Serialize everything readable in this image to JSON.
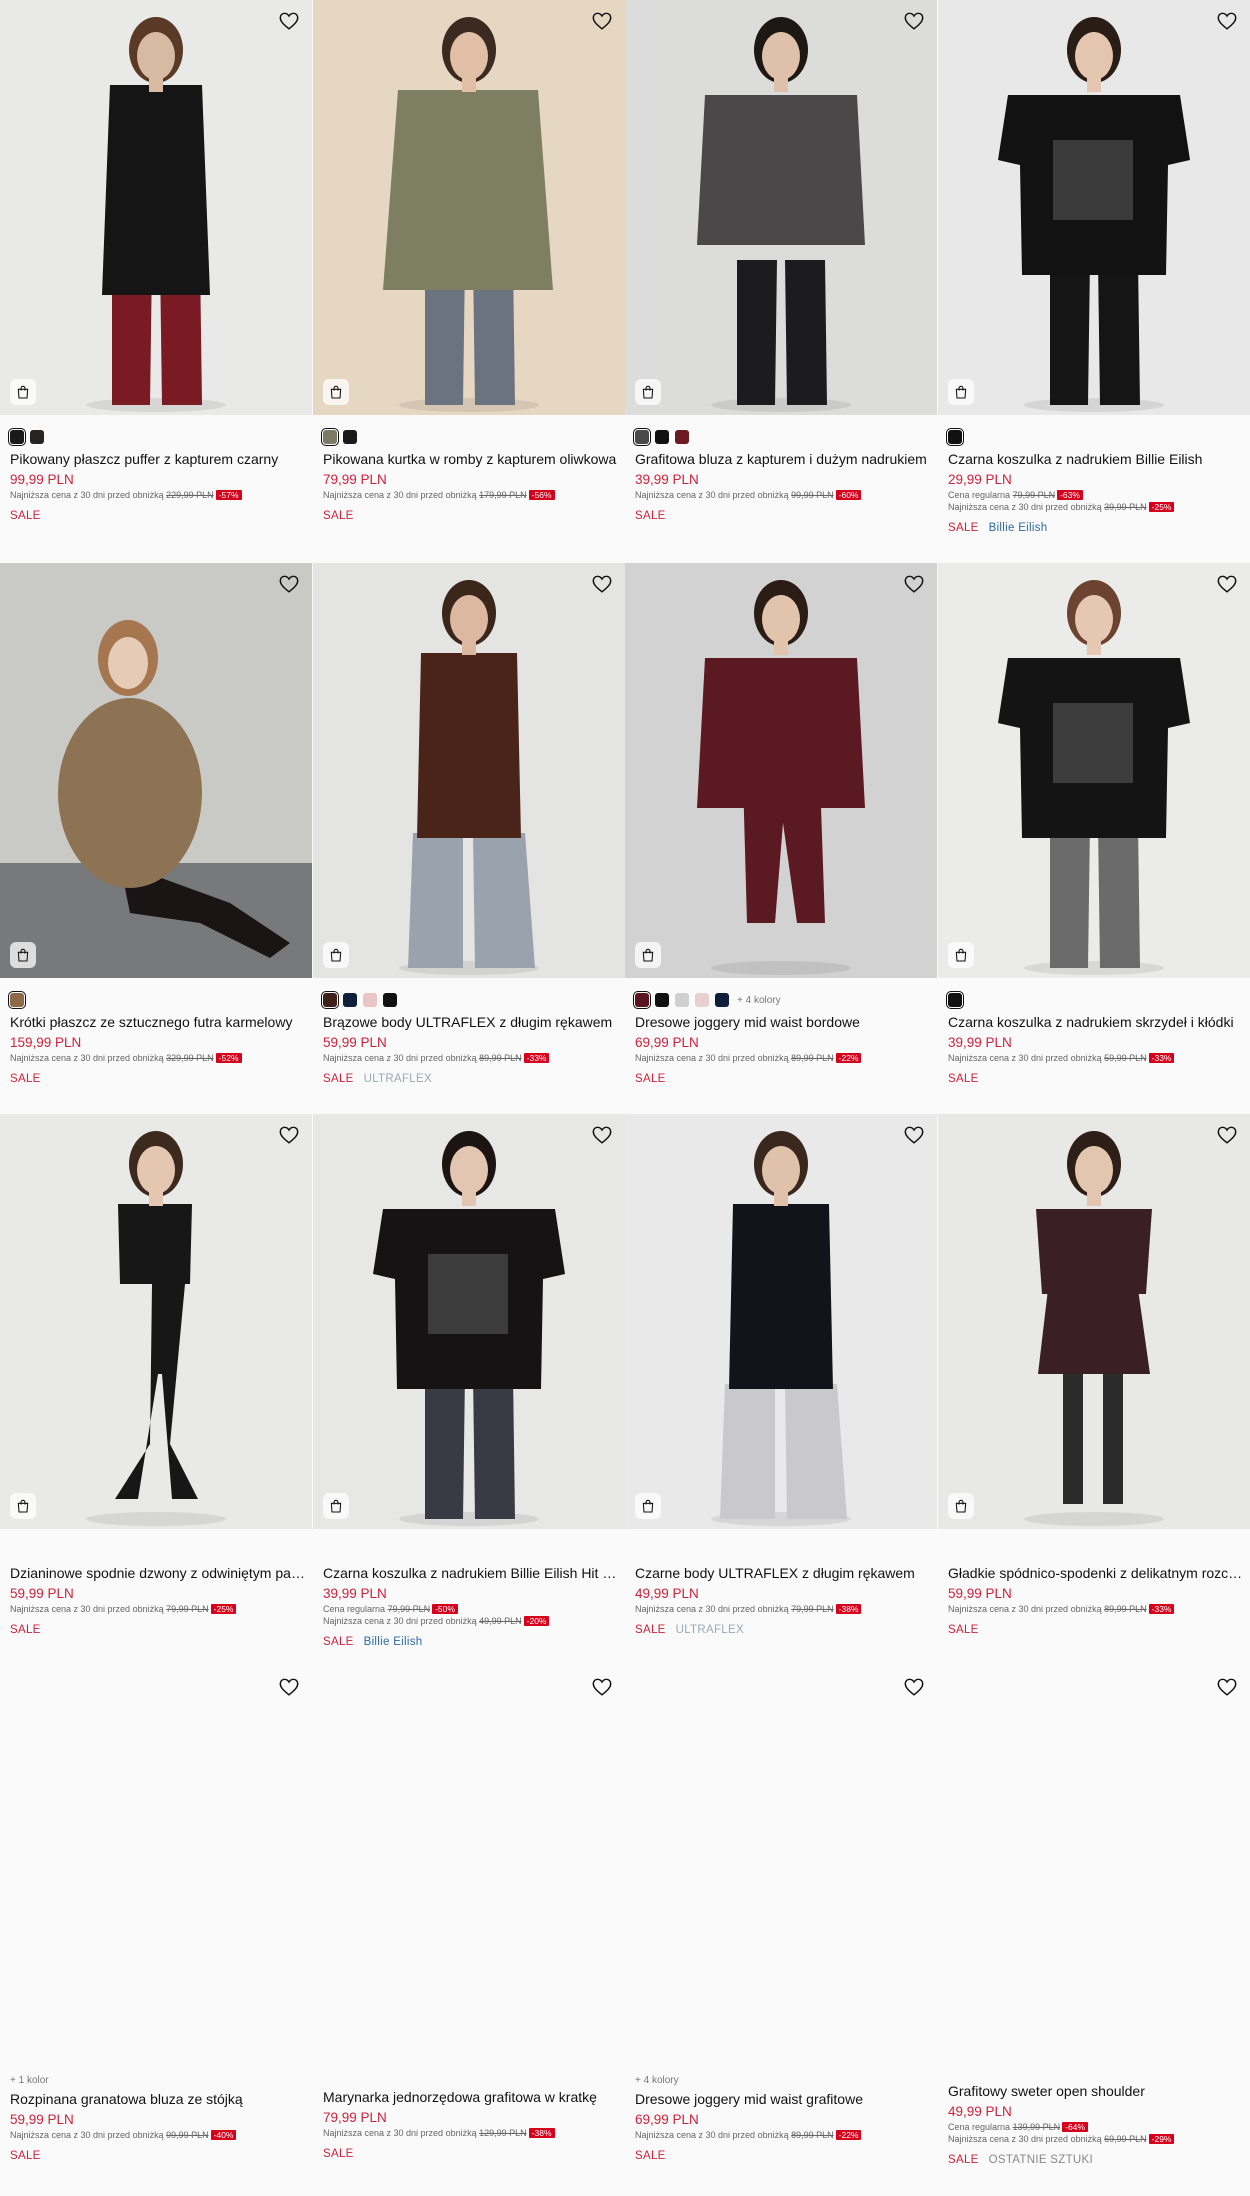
{
  "products": [
    {
      "name": "Pikowany płaszcz puffer z kapturem czarny",
      "price": "99,99 PLN",
      "lines": [
        {
          "label": "Najniższa cena z 30 dni przed obniżką",
          "old": "229,99 PLN",
          "discount": "-57%"
        }
      ],
      "tags": {
        "sale": "SALE"
      },
      "swatches": [
        "#1a1a1a",
        "#2a2420"
      ],
      "image": {
        "bg": "#e9e9e7",
        "garment": "#151515",
        "lower": "#7a1a22",
        "skin": "#d8b9a2",
        "hair": "#5a3a26",
        "style": "long"
      }
    },
    {
      "name": "Pikowana kurtka w romby z kapturem oliwkowa",
      "price": "79,99 PLN",
      "lines": [
        {
          "label": "Najniższa cena z 30 dni przed obniżką",
          "old": "179,99 PLN",
          "discount": "-56%"
        }
      ],
      "tags": {
        "sale": "SALE"
      },
      "swatches": [
        "#7b7b66",
        "#1a1a1a"
      ],
      "image": {
        "bg": "#e6d7c2",
        "garment": "#7e7f62",
        "lower": "#6c7380",
        "skin": "#e0bfa6",
        "hair": "#3b2a1f",
        "style": "jacket"
      }
    },
    {
      "name": "Grafitowa bluza z kapturem i dużym nadrukiem",
      "price": "39,99 PLN",
      "lines": [
        {
          "label": "Najniższa cena z 30 dni przed obniżką",
          "old": "99,99 PLN",
          "discount": "-60%"
        }
      ],
      "tags": {
        "sale": "SALE"
      },
      "swatches": [
        "#4a4a4a",
        "#111111",
        "#6b1a22"
      ],
      "image": {
        "bg": "#dcdcdb",
        "garment": "#4b4849",
        "lower": "#1c1c1e",
        "skin": "#dfc0aa",
        "hair": "#1e1814",
        "style": "hoodie"
      }
    },
    {
      "name": "Czarna koszulka z nadrukiem Billie Eilish",
      "price": "29,99 PLN",
      "lines": [
        {
          "label": "Cena regularna",
          "old": "79,99 PLN",
          "discount": "-63%"
        },
        {
          "label": "Najniższa cena z 30 dni przed obniżką",
          "old": "39,99 PLN",
          "discount": "-25%"
        }
      ],
      "tags": {
        "sale": "SALE",
        "brand": "Billie Eilish"
      },
      "swatches": [
        "#111111"
      ],
      "image": {
        "bg": "#e8e8e8",
        "garment": "#121212",
        "lower": "#151515",
        "skin": "#e3c5b0",
        "hair": "#2a1d16",
        "style": "tee"
      }
    },
    {
      "name": "Krótki płaszcz ze sztucznego futra karmelowy",
      "price": "159,99 PLN",
      "lines": [
        {
          "label": "Najniższa cena z 30 dni przed obniżką",
          "old": "329,99 PLN",
          "discount": "-52%"
        }
      ],
      "tags": {
        "sale": "SALE"
      },
      "swatches": [
        "#8c6a48"
      ],
      "image": {
        "bg": "#c9c9c6",
        "garment": "#8d7354",
        "lower": "#1a1414",
        "skin": "#e6cbb6",
        "hair": "#a5764f",
        "style": "fur"
      }
    },
    {
      "name": "Brązowe body ULTRAFLEX z długim rękawem",
      "price": "59,99 PLN",
      "lines": [
        {
          "label": "Najniższa cena z 30 dni przed obniżką",
          "old": "89,99 PLN",
          "discount": "-33%"
        }
      ],
      "tags": {
        "sale": "SALE",
        "brand": "ULTRAFLEX",
        "brand_style": "grey"
      },
      "swatches": [
        "#3d2118",
        "#0f1f3a",
        "#e8c6c6",
        "#111111"
      ],
      "image": {
        "bg": "#e4e4e2",
        "garment": "#4a2418",
        "lower": "#9aa3ad",
        "skin": "#dcb8a0",
        "hair": "#3b261c",
        "style": "body"
      }
    },
    {
      "name": "Dresowe joggery mid waist bordowe",
      "price": "69,99 PLN",
      "lines": [
        {
          "label": "Najniższa cena z 30 dni przed obniżką",
          "old": "89,99 PLN",
          "discount": "-22%"
        }
      ],
      "tags": {
        "sale": "SALE"
      },
      "swatches": [
        "#5a1520",
        "#111111",
        "#cfcfcf",
        "#e8cfd2",
        "#0f1f3a"
      ],
      "more_colors": "+ 4 kolory",
      "image": {
        "bg": "#d2d2d2",
        "garment": "#5b1a22",
        "lower": "#5b1a22",
        "skin": "#e2c4ad",
        "hair": "#2b1d16",
        "style": "jogger"
      }
    },
    {
      "name": "Czarna koszulka z nadrukiem skrzydeł i kłódki",
      "price": "39,99 PLN",
      "lines": [
        {
          "label": "Najniższa cena z 30 dni przed obniżką",
          "old": "59,99 PLN",
          "discount": "-33%"
        }
      ],
      "tags": {
        "sale": "SALE"
      },
      "swatches": [
        "#111111"
      ],
      "image": {
        "bg": "#ebebea",
        "garment": "#141414",
        "lower": "#6b6b6b",
        "skin": "#e6c8b2",
        "hair": "#6b4330",
        "style": "tee"
      }
    },
    {
      "name": "Dzianinowe spodnie dzwony z odwiniętym pasem",
      "price": "59,99 PLN",
      "lines": [
        {
          "label": "Najniższa cena z 30 dni przed obniżką",
          "old": "79,99 PLN",
          "discount": "-25%"
        }
      ],
      "tags": {
        "sale": "SALE"
      },
      "swatches": [],
      "image": {
        "bg": "#e9e9e8",
        "garment": "#171717",
        "lower": "#171717",
        "skin": "#e5c7b1",
        "hair": "#3d2a1f",
        "style": "flare"
      }
    },
    {
      "name": "Czarna koszulka z nadrukiem Billie Eilish Hit Me Hard",
      "price": "39,99 PLN",
      "lines": [
        {
          "label": "Cena regularna",
          "old": "79,99 PLN",
          "discount": "-50%"
        },
        {
          "label": "Najniższa cena z 30 dni przed obniżką",
          "old": "49,99 PLN",
          "discount": "-20%"
        }
      ],
      "tags": {
        "sale": "SALE",
        "brand": "Billie Eilish"
      },
      "swatches": [],
      "image": {
        "bg": "#e7e7e6",
        "garment": "#151313",
        "lower": "#3a3a44",
        "skin": "#e3c6b1",
        "hair": "#1b1412",
        "style": "tee"
      }
    },
    {
      "name": "Czarne body ULTRAFLEX z długim rękawem",
      "price": "49,99 PLN",
      "lines": [
        {
          "label": "Najniższa cena z 30 dni przed obniżką",
          "old": "79,99 PLN",
          "discount": "-38%"
        }
      ],
      "tags": {
        "sale": "SALE",
        "brand": "ULTRAFLEX",
        "brand_style": "grey"
      },
      "swatches": [],
      "image": {
        "bg": "#e9e9e9",
        "garment": "#12141c",
        "lower": "#c9c9cb",
        "skin": "#e0c2ab",
        "hair": "#3a281e",
        "style": "bodysweat"
      }
    },
    {
      "name": "Gładkie spódnico-spodenki z delikatnym rozcięciem",
      "price": "59,99 PLN",
      "lines": [
        {
          "label": "Najniższa cena z 30 dni przed obniżką",
          "old": "89,99 PLN",
          "discount": "-33%"
        }
      ],
      "tags": {
        "sale": "SALE"
      },
      "swatches": [],
      "image": {
        "bg": "#e8e8e7",
        "garment": "#3a1f26",
        "lower": "#3a1f26",
        "skin": "#e3c6b0",
        "hair": "#2d1f18",
        "style": "skirt"
      }
    },
    {
      "name": "Rozpinana granatowa bluza ze stójką",
      "price": "59,99 PLN",
      "colors_count": "+ 1 kolor",
      "lines": [
        {
          "label": "Najniższa cena z 30 dni przed obniżką",
          "old": "99,99 PLN",
          "discount": "-40%"
        }
      ],
      "tags": {
        "sale": "SALE"
      },
      "swatches": [],
      "image": null
    },
    {
      "name": "Marynarka jednorzędowa grafitowa w kratkę",
      "price": "79,99 PLN",
      "lines": [
        {
          "label": "Najniższa cena z 30 dni przed obniżką",
          "old": "129,99 PLN",
          "discount": "-38%"
        }
      ],
      "tags": {
        "sale": "SALE"
      },
      "swatches": [],
      "image": null
    },
    {
      "name": "Dresowe joggery mid waist grafitowe",
      "price": "69,99 PLN",
      "colors_count": "+ 4 kolory",
      "lines": [
        {
          "label": "Najniższa cena z 30 dni przed obniżką",
          "old": "89,99 PLN",
          "discount": "-22%"
        }
      ],
      "tags": {
        "sale": "SALE"
      },
      "swatches": [],
      "image": null
    },
    {
      "name": "Grafitowy sweter open shoulder",
      "price": "49,99 PLN",
      "lines": [
        {
          "label": "Cena regularna",
          "old": "139,99 PLN",
          "discount": "-64%"
        },
        {
          "label": "Najniższa cena z 30 dni przed obniżką",
          "old": "69,99 PLN",
          "discount": "-29%"
        }
      ],
      "tags": {
        "sale": "SALE",
        "last": "OSTATNIE SZTUKI"
      },
      "swatches": [],
      "image": null
    }
  ],
  "colors": {
    "price": "#d0213b",
    "badge": "#d6001c",
    "brand": "#2b6aa6",
    "brand_grey": "#9aa8b6"
  },
  "icons": {
    "wishlist": "heart-icon",
    "quick_add": "shopping-bag-icon"
  }
}
